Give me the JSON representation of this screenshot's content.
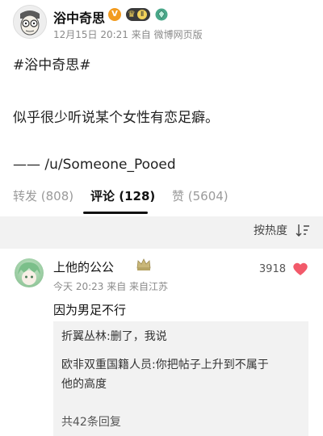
{
  "post": {
    "author": "浴中奇思",
    "level_badge": "Ⅱ",
    "verified_badge": "V",
    "meta": "12月15日 20:21  来自 微博网页版",
    "hashtag": "#浴中奇思#",
    "content": "似乎很少听说某个女性有恋足癖。",
    "source": "—— /u/Someone_Pooed"
  },
  "tabs": [
    {
      "label": "转发 (808)"
    },
    {
      "label": "评论 (128)"
    },
    {
      "label": "赞 (5604)"
    }
  ],
  "sort": {
    "label": "按热度"
  },
  "comment": {
    "author": "上他的公公",
    "meta": "今天 20:23  来自  来自江苏",
    "likes": "3918",
    "text": "因为男足不行",
    "replies": [
      {
        "text": "折翼丛林:删了，我说"
      },
      {
        "text_line1": "欧非双重国籍人员:你把帖子上升到不属于",
        "text_line2": "他的高度"
      }
    ],
    "reply_count": "共42条回复"
  },
  "colors": {
    "accent_heart": "#f25a6a",
    "background_band": "#f2f2f2"
  }
}
